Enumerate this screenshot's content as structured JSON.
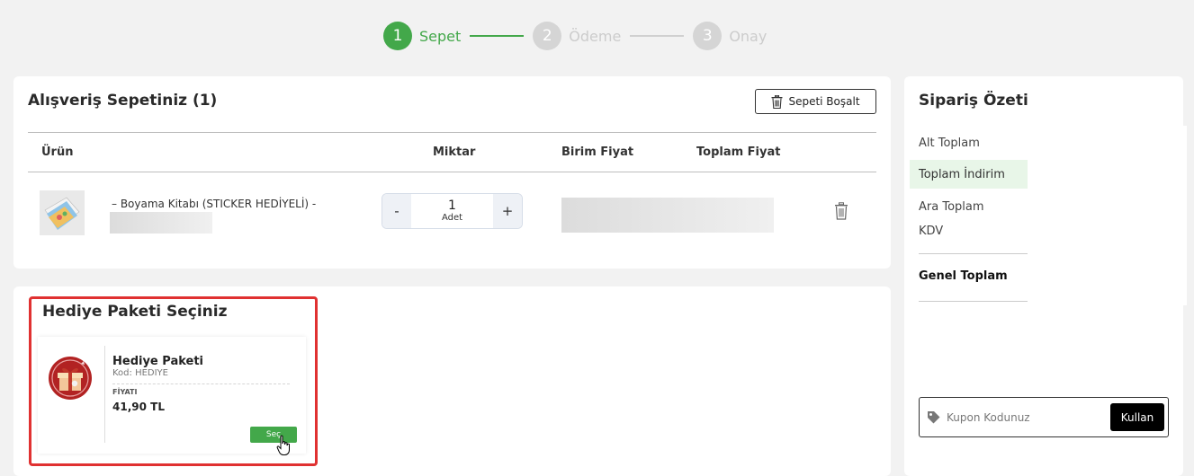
{
  "stepper": {
    "steps": [
      {
        "num": "1",
        "label": "Sepet"
      },
      {
        "num": "2",
        "label": "Ödeme"
      },
      {
        "num": "3",
        "label": "Onay"
      }
    ],
    "active_step": 1,
    "colors": {
      "active": "#43a84a",
      "inactive": "#d5d5d5"
    }
  },
  "cart": {
    "title": "Alışveriş Sepetiniz (1)",
    "empty_button": "Sepeti Boşalt",
    "columns": [
      "Ürün",
      "Miktar",
      "Birim Fiyat",
      "Toplam Fiyat"
    ],
    "items": [
      {
        "name": "– Boyama Kitabı (STICKER HEDİYELİ) -",
        "quantity": "1",
        "unit": "Adet",
        "minus": "-",
        "plus": "+"
      }
    ]
  },
  "gift": {
    "title": "Hediye Paketi Seçiniz",
    "name": "Hediye Paketi",
    "code": "Kod: HEDIYE",
    "price_label": "FİYATI",
    "price": "41,90 TL",
    "select_button": "Seç"
  },
  "summary": {
    "title": "Sipariş Özeti",
    "subtotal_label": "Alt Toplam",
    "discount_label": "Toplam İndirim",
    "intermediate_label": "Ara Toplam",
    "tax_label": "KDV",
    "grand_total_label": "Genel Toplam",
    "coupon_placeholder": "Kupon Kodunuz",
    "coupon_button": "Kullan"
  }
}
